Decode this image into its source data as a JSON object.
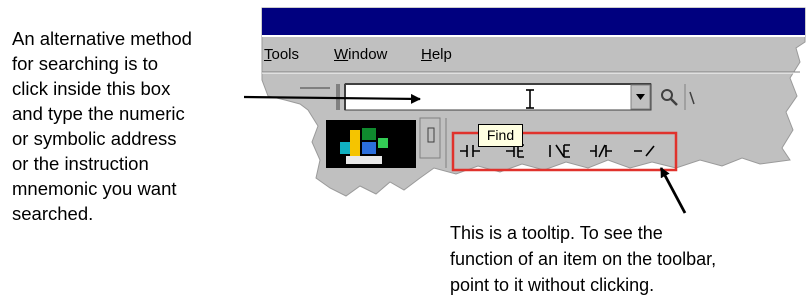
{
  "menu": {
    "tools": {
      "first": "T",
      "rest": "ools"
    },
    "window": {
      "first": "W",
      "rest": "indow"
    },
    "help": {
      "first": "H",
      "rest": "elp"
    }
  },
  "tooltip": {
    "label": "Find"
  },
  "toolbar_buttons": [
    "-|",
    "-E",
    "|E",
    "-|E",
    "-|/"
  ],
  "icons": [
    "dropdown-arrow-icon",
    "text-cursor-icon",
    "find-icon",
    "program-icon",
    "pointer-arrow-icon"
  ],
  "colors": {
    "title_bar": "#00007f",
    "window_face": "#c0c0c0",
    "highlight_box": "#e0322c",
    "tooltip_bg": "#ffffe1"
  },
  "callouts": {
    "left": [
      "An alternative method",
      "for searching is to",
      "click inside this box",
      "and type the numeric",
      "or symbolic address",
      "or the instruction",
      "mnemonic you want",
      "searched."
    ],
    "right": [
      "This is a tooltip. To see the",
      "function of an item on the toolbar,",
      "point to it without clicking."
    ]
  }
}
